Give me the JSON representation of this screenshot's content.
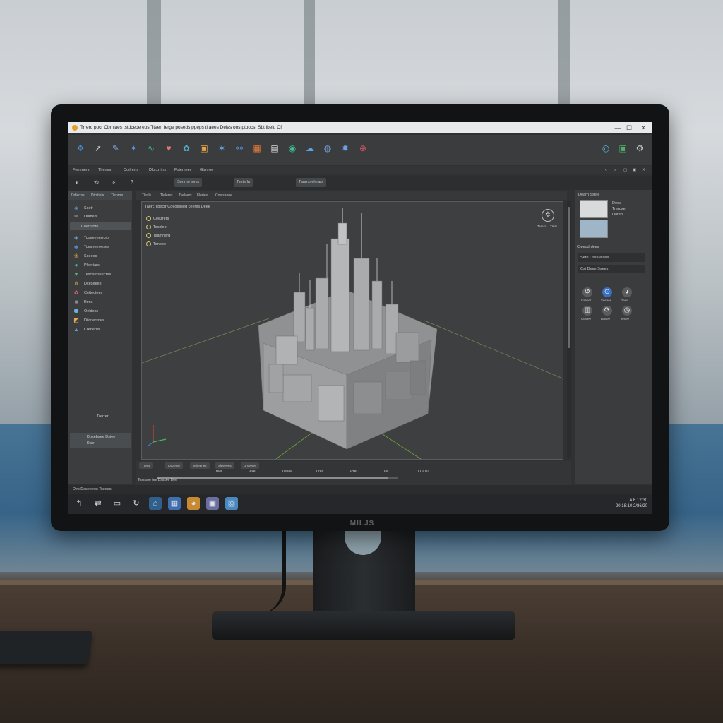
{
  "monitor": {
    "brand": "MILJS"
  },
  "app": {
    "title": "Trrerc pocr  Cbmlaes tstdceoe eos  Tteen  Ierge poseds ppeps tl.aees  Deias oos ptoocs. Sbt ibeiu Of",
    "window_controls": [
      "—",
      "☐",
      "✕"
    ]
  },
  "toolbar": {
    "tools": [
      {
        "icon": "move-icon",
        "glyph": "✥",
        "color": "#4a8fd6"
      },
      {
        "icon": "arrow-icon",
        "glyph": "➚",
        "color": "#cfd3d6"
      },
      {
        "icon": "pen-icon",
        "glyph": "✎",
        "color": "#7fb0e0"
      },
      {
        "icon": "transform-icon",
        "glyph": "✦",
        "color": "#5b9bd8"
      },
      {
        "icon": "path-icon",
        "glyph": "∿",
        "color": "#3fb87a"
      },
      {
        "icon": "heart-icon",
        "glyph": "♥",
        "color": "#e07a6a"
      },
      {
        "icon": "paint-icon",
        "glyph": "✿",
        "color": "#4fb0c6"
      },
      {
        "icon": "image-icon",
        "glyph": "▣",
        "color": "#e6a24a"
      },
      {
        "icon": "node-icon",
        "glyph": "✶",
        "color": "#6aa8e6"
      },
      {
        "icon": "link-icon",
        "glyph": "⚯",
        "color": "#5d8fe0"
      },
      {
        "icon": "render-icon",
        "glyph": "▦",
        "color": "#e07a3a"
      },
      {
        "icon": "grid-icon",
        "glyph": "▤",
        "color": "#d9d9d9"
      },
      {
        "icon": "globe-icon",
        "glyph": "◉",
        "color": "#3fbf9a"
      },
      {
        "icon": "cloud-icon",
        "glyph": "☁",
        "color": "#5aa3e6"
      },
      {
        "icon": "world-icon",
        "glyph": "◍",
        "color": "#7a9fe0"
      },
      {
        "icon": "light-icon",
        "glyph": "✹",
        "color": "#6ea0e8"
      },
      {
        "icon": "camera-icon",
        "glyph": "⊕",
        "color": "#d0566a"
      }
    ],
    "right_tools": [
      {
        "icon": "view-icon",
        "glyph": "◎",
        "color": "#5ab0d6"
      },
      {
        "icon": "terminal-icon",
        "glyph": "▣",
        "color": "#4fb06a"
      },
      {
        "icon": "settings-icon",
        "glyph": "⚙",
        "color": "#c9ccce"
      }
    ]
  },
  "menubar": {
    "items": [
      "Frenmers",
      "Tlrenes",
      "Cotlrerrs",
      "Dlorzrrirrs",
      "Fotemeer",
      "Gtrrrroe"
    ],
    "right_icons": [
      "‹",
      "»",
      "▢",
      "▣",
      "✕"
    ]
  },
  "options": {
    "left": [
      "◐",
      "⟲",
      "⊙",
      "3"
    ],
    "fields": [
      "Sonrno  toms",
      "Tsete la",
      "Tanrno elvrars"
    ]
  },
  "left_panel": {
    "tabs": [
      "Ddlerrss",
      "Dtrstiele",
      "Tlenrrrs"
    ],
    "items": [
      {
        "label": "Scetr",
        "icon": "layers-icon",
        "glyph": "◈",
        "color": "#6a9bd0"
      },
      {
        "label": "Dumeis",
        "icon": "tools-icon",
        "glyph": "✂",
        "color": "#9aa0a4"
      },
      {
        "label": "Ceetrl  Bte",
        "icon": "",
        "glyph": "",
        "color": "",
        "selected": true
      },
      {
        "label": "Tcoeeeeerrces",
        "icon": "material-icon",
        "glyph": "◈",
        "color": "#7a9fe0"
      },
      {
        "label": "Tcesnerreeses",
        "icon": "shader-icon",
        "glyph": "◆",
        "color": "#4e86c8"
      },
      {
        "label": "Sceoes",
        "icon": "texture-icon",
        "glyph": "❀",
        "color": "#d69a3a"
      },
      {
        "label": "Ploeriars",
        "icon": "sphere-icon",
        "glyph": "●",
        "color": "#3fb8a6"
      },
      {
        "label": "Tescernssecres",
        "icon": "vector-icon",
        "glyph": "▼",
        "color": "#4fc07a"
      },
      {
        "label": "Dceseees",
        "icon": "node-tree-icon",
        "glyph": "⋔",
        "color": "#c8a050"
      },
      {
        "label": "Cettectees",
        "icon": "palette-icon",
        "glyph": "✿",
        "color": "#d46a7a"
      },
      {
        "label": "Eees",
        "icon": "cube-icon",
        "glyph": "■",
        "color": "#8a8f94"
      },
      {
        "label": "Oeldess",
        "icon": "mesh-icon",
        "glyph": "⬢",
        "color": "#6ab0e0"
      },
      {
        "label": "Dilcnersnes",
        "icon": "hdri-icon",
        "glyph": "◩",
        "color": "#e0b050"
      },
      {
        "label": "Crenerds",
        "icon": "object-icon",
        "glyph": "▲",
        "color": "#5a9fe0"
      }
    ],
    "button": "Trerrer",
    "footer_title": "Dosebsee  Dsiee",
    "footer_sub": "Dsre"
  },
  "viewport": {
    "tabs": [
      "Tlesls",
      "Tlelerss",
      "Tselaers",
      "Fleries",
      "Coelsaene"
    ],
    "header": "Taerc  Tpecrr  Coeoessed  ceeres  Deee",
    "options": [
      "Ceezrers",
      "Tcsoleo",
      "Tsamnerd",
      "Tonooe"
    ],
    "compass_labels": [
      "Tseuo",
      "Tlesr"
    ],
    "grid": "on"
  },
  "timeline": {
    "buttons": [
      "Ttees",
      "Tcezerse",
      "Telreenes",
      "Sleeeees",
      "Drseeres"
    ],
    "markers": [
      "Treer",
      "Tese",
      "Tlesoe",
      "Tlres",
      "Tcrer",
      "Ter",
      "T19 10"
    ],
    "status": "Tesnone  tee  Dsssee  Dee",
    "progress": 0.96
  },
  "status_bar": {
    "text": "Dlrs  Dsseeees  Tseees"
  },
  "right_panel": {
    "header": "Dearn  Ssele",
    "thumb_labels": [
      "Deoa",
      "Trerdse",
      "Daren"
    ],
    "section": "Cteeodrdees",
    "fields": [
      "Sere  Dsse  elsee",
      "Csi  Deee  Ssees"
    ],
    "icons": [
      {
        "icon": "history-icon",
        "glyph": "↺",
        "color": "#5a5d60",
        "label": "Cseser"
      },
      {
        "icon": "search-icon",
        "glyph": "⊙",
        "color": "#3a6fc0",
        "label": "Sesaee"
      },
      {
        "icon": "chrome-icon",
        "glyph": "◕",
        "color": "#5a5d60",
        "label": "Deee"
      },
      {
        "icon": "book-icon",
        "glyph": "▥",
        "color": "#5a5d60",
        "label": "Cesiee"
      },
      {
        "icon": "refresh-icon",
        "glyph": "⟳",
        "color": "#5a5d60",
        "label": "Dasee"
      },
      {
        "icon": "clock-icon",
        "glyph": "◷",
        "color": "#5a5d60",
        "label": "Tesee"
      }
    ]
  },
  "taskbar": {
    "icons": [
      {
        "icon": "back-icon",
        "glyph": "↰",
        "color": "transparent"
      },
      {
        "icon": "switch-icon",
        "glyph": "⇄",
        "color": "transparent"
      },
      {
        "icon": "window-icon",
        "glyph": "▭",
        "color": "transparent"
      },
      {
        "icon": "refresh-icon",
        "glyph": "↻",
        "color": "transparent"
      },
      {
        "icon": "home-icon",
        "glyph": "⌂",
        "color": "#2f5f8a"
      },
      {
        "icon": "app-grid-icon",
        "glyph": "▦",
        "color": "#3f6fb0"
      },
      {
        "icon": "browser-icon",
        "glyph": "◕",
        "color": "#c88a30"
      },
      {
        "icon": "photo-icon",
        "glyph": "▣",
        "color": "#6a6fa0"
      },
      {
        "icon": "3d-app-icon",
        "glyph": "▨",
        "color": "#4a88c0"
      }
    ],
    "clock_line1": "A:6  12:30",
    "clock_line2": "20 18:10  2/86/20"
  }
}
